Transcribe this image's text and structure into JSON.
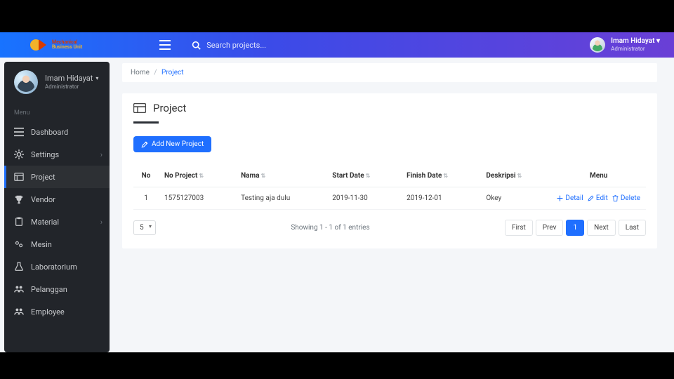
{
  "logo": {
    "line1": "Mechanical",
    "line2": "Business Unit"
  },
  "search": {
    "placeholder": "Search projects..."
  },
  "user": {
    "name": "Imam Hidayat",
    "role": "Administrator"
  },
  "sidebar": {
    "menu_label": "Menu",
    "items": [
      {
        "label": "Dashboard"
      },
      {
        "label": "Settings"
      },
      {
        "label": "Project"
      },
      {
        "label": "Vendor"
      },
      {
        "label": "Material"
      },
      {
        "label": "Mesin"
      },
      {
        "label": "Laboratorium"
      },
      {
        "label": "Pelanggan"
      },
      {
        "label": "Employee"
      }
    ]
  },
  "breadcrumb": {
    "home": "Home",
    "current": "Project"
  },
  "page": {
    "title": "Project",
    "add_button": "Add New Project"
  },
  "table": {
    "headers": {
      "no": "No",
      "no_project": "No Project",
      "nama": "Nama",
      "start": "Start Date",
      "finish": "Finish Date",
      "deskripsi": "Deskripsi",
      "menu": "Menu"
    },
    "rows": [
      {
        "no": "1",
        "no_project": "1575127003",
        "nama": "Testing aja dulu",
        "start": "2019-11-30",
        "finish": "2019-12-01",
        "deskripsi": "Okey"
      }
    ],
    "actions": {
      "detail": "Detail",
      "edit": "Edit",
      "delete": "Delete"
    }
  },
  "footer": {
    "page_size": "5",
    "info": "Showing 1 - 1 of 1 entries",
    "pagination": {
      "first": "First",
      "prev": "Prev",
      "page": "1",
      "next": "Next",
      "last": "Last"
    }
  }
}
